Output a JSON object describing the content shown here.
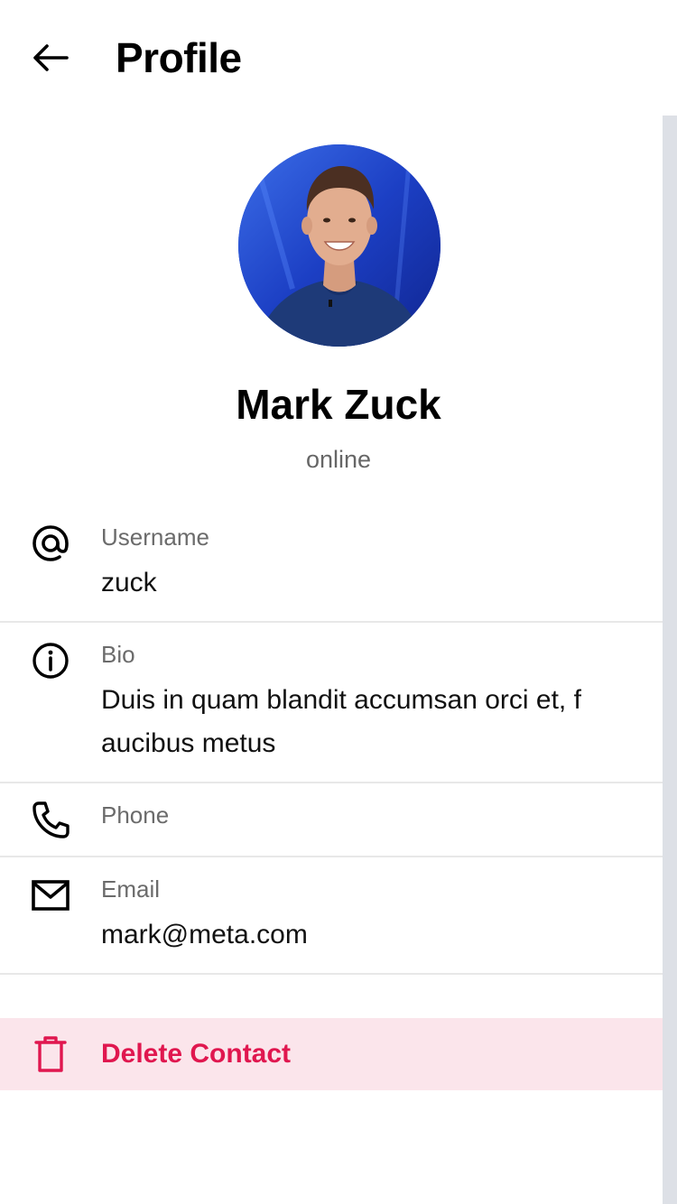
{
  "header": {
    "title": "Profile",
    "back_icon": "arrow-left-icon"
  },
  "profile": {
    "name": "Mark Zuck",
    "status": "online",
    "avatar_colors": {
      "background": "#1f44c9",
      "shirt": "#1e3a78",
      "skin": "#e2ad8f",
      "hair": "#4b2f22"
    }
  },
  "fields": {
    "username": {
      "label": "Username",
      "value": "zuck",
      "icon": "at-sign-icon"
    },
    "bio": {
      "label": "Bio",
      "value_line1": "Duis in quam blandit accumsan orci et, f",
      "value_line2": "aucibus metus",
      "icon": "info-icon"
    },
    "phone": {
      "label": "Phone",
      "icon": "phone-icon"
    },
    "email": {
      "label": "Email",
      "value": "mark@meta.com",
      "icon": "mail-icon"
    }
  },
  "actions": {
    "delete_label": "Delete Contact",
    "delete_icon": "trash-icon",
    "delete_color": "#e0174f",
    "delete_background": "#fbe5eb"
  },
  "colors": {
    "label": "#6b6b6b",
    "divider": "#e8e8e8",
    "scrollbar": "#dde0e6"
  }
}
